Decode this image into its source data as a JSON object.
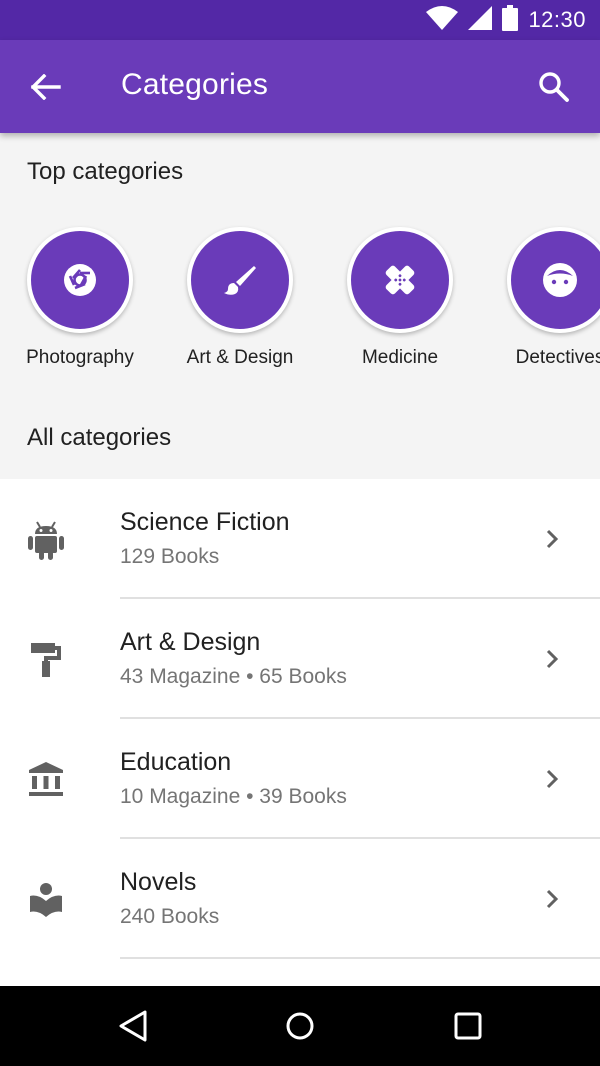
{
  "status_bar": {
    "time": "12:30",
    "icons": [
      "wifi-icon",
      "signal-icon",
      "battery-icon"
    ]
  },
  "app_bar": {
    "title": "Categories",
    "back_icon": "arrow-back-icon",
    "search_icon": "search-icon"
  },
  "sections": {
    "top": "Top categories",
    "all": "All categories"
  },
  "top_categories": [
    {
      "label": "Photography",
      "icon": "camera-aperture-icon"
    },
    {
      "label": "Art & Design",
      "icon": "brush-icon"
    },
    {
      "label": "Medicine",
      "icon": "bandage-icon"
    },
    {
      "label": "Detectives",
      "icon": "face-icon"
    }
  ],
  "categories": [
    {
      "name": "Science Fiction",
      "count": "129 Books",
      "icon": "android-icon"
    },
    {
      "name": "Art & Design",
      "count": "43 Magazine • 65 Books",
      "icon": "paint-roller-icon"
    },
    {
      "name": "Education",
      "count": "10 Magazine • 39 Books",
      "icon": "bank-icon"
    },
    {
      "name": "Novels",
      "count": "240 Books",
      "icon": "book-reader-icon"
    }
  ],
  "colors": {
    "primary": "#6a3bb9",
    "primary_dark": "#5328a6",
    "icon_gray": "#616161"
  }
}
